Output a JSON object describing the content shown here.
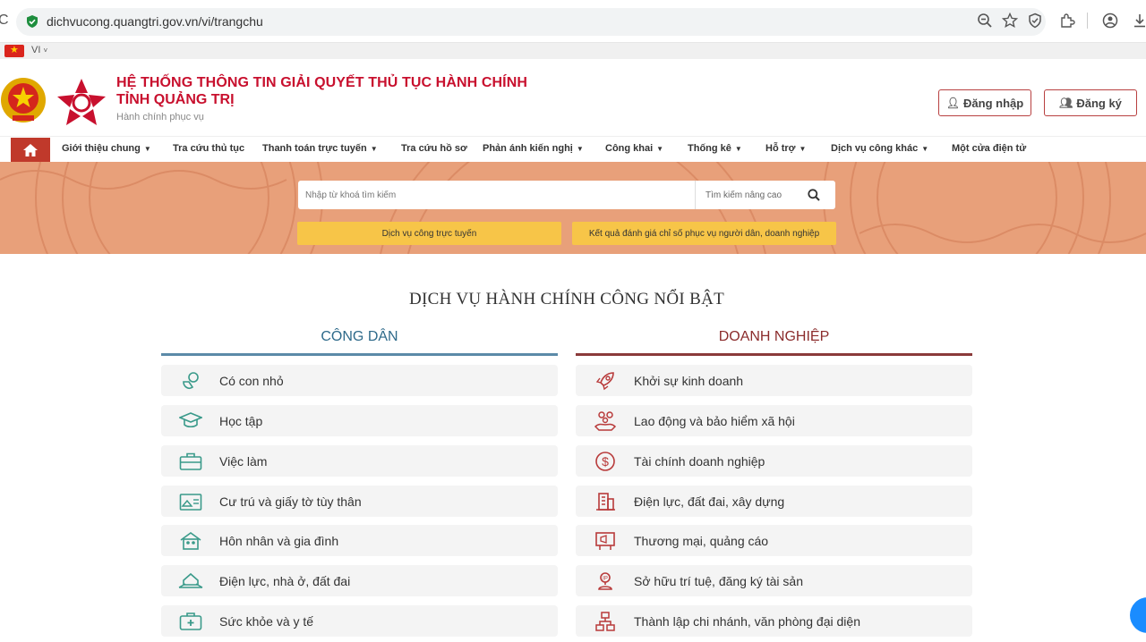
{
  "browser": {
    "url": "dichvucong.quangtri.gov.vn/vi/trangchu"
  },
  "lang": {
    "code": "VI"
  },
  "header": {
    "title_line1": "HỆ THỐNG THÔNG TIN GIẢI QUYẾT THỦ TỤC HÀNH CHÍNH",
    "title_line2": "TỈNH QUẢNG TRỊ",
    "subtitle": "Hành chính phục vụ",
    "login_label": "Đăng nhập",
    "register_label": "Đăng ký"
  },
  "nav": {
    "items": [
      {
        "label": "Giới thiệu chung",
        "dropdown": true
      },
      {
        "label": "Tra cứu thủ tục",
        "dropdown": false
      },
      {
        "label": "Thanh toán trực tuyến",
        "dropdown": true
      },
      {
        "label": "Tra cứu hồ sơ",
        "dropdown": false
      },
      {
        "label": "Phản ánh kiến nghị",
        "dropdown": true
      },
      {
        "label": "Công khai",
        "dropdown": true
      },
      {
        "label": "Thống kê",
        "dropdown": true
      },
      {
        "label": "Hỗ trợ",
        "dropdown": true
      },
      {
        "label": "Dịch vụ công khác",
        "dropdown": true
      },
      {
        "label": "Một cửa điện tử",
        "dropdown": false
      }
    ]
  },
  "search": {
    "placeholder": "Nhập từ khoá tìm kiếm",
    "advanced_label": "Tìm kiếm nâng cao",
    "online_service_label": "Dịch vụ công trực tuyến",
    "evaluation_label": "Kết quả đánh giá chỉ số phục vụ người dân, doanh nghiệp"
  },
  "main": {
    "section_title": "DỊCH VỤ HÀNH CHÍNH CÔNG NỔI BẬT",
    "citizen": {
      "heading": "CÔNG DÂN",
      "items": [
        {
          "label": "Có con nhỏ",
          "icon": "baby-icon"
        },
        {
          "label": "Học tập",
          "icon": "graduation-cap-icon"
        },
        {
          "label": "Việc làm",
          "icon": "briefcase-icon"
        },
        {
          "label": "Cư trú và giấy tờ tùy thân",
          "icon": "id-card-icon"
        },
        {
          "label": "Hôn nhân và gia đình",
          "icon": "family-home-icon"
        },
        {
          "label": "Điện lực, nhà ở, đất đai",
          "icon": "house-land-icon"
        },
        {
          "label": "Sức khỏe và y tế",
          "icon": "medical-kit-icon"
        }
      ]
    },
    "business": {
      "heading": "DOANH NGHIỆP",
      "items": [
        {
          "label": "Khởi sự kinh doanh",
          "icon": "rocket-icon"
        },
        {
          "label": "Lao động và bảo hiểm xã hội",
          "icon": "workers-icon"
        },
        {
          "label": "Tài chính doanh nghiệp",
          "icon": "dollar-icon"
        },
        {
          "label": "Điện lực, đất đai, xây dựng",
          "icon": "building-icon"
        },
        {
          "label": "Thương mại, quảng cáo",
          "icon": "billboard-icon"
        },
        {
          "label": "Sở hữu trí tuệ, đăng ký tài sản",
          "icon": "ip-icon"
        },
        {
          "label": "Thành lập chi nhánh, văn phòng đại diện",
          "icon": "org-chart-icon"
        }
      ]
    }
  },
  "colors": {
    "brand_red": "#c8102e",
    "citizen_accent": "#2e7d9a",
    "business_accent": "#8b2c2c",
    "icon_teal": "#3a9a8a",
    "icon_red": "#b83a3a",
    "button_yellow": "#f7c548",
    "banner_orange": "#e8a07a"
  }
}
